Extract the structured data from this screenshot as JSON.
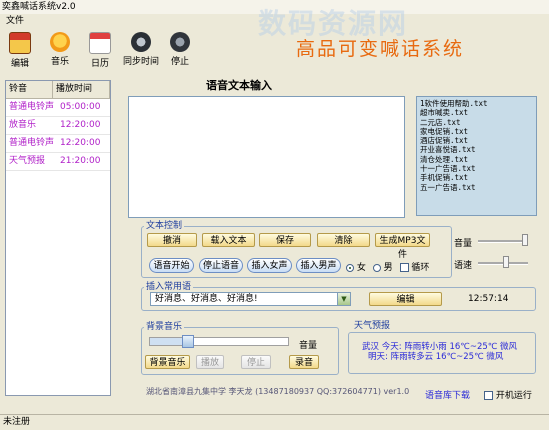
{
  "window": {
    "title": "奕鑫喊话系统v2.0"
  },
  "menu": {
    "file": "文件"
  },
  "toolbar": {
    "items": [
      {
        "label": "编辑",
        "icon": "calendar-red-icon"
      },
      {
        "label": "音乐",
        "icon": "music-face-icon"
      },
      {
        "label": "日历",
        "icon": "calendar-icon"
      },
      {
        "label": "同步时间",
        "icon": "clock-sync-icon"
      },
      {
        "label": "停止",
        "icon": "stop-icon"
      }
    ],
    "brand": "高品可变喊话系统"
  },
  "watermark": "数码资源网",
  "schedule": {
    "headers": [
      "铃音",
      "播放时间"
    ],
    "rows": [
      {
        "name": "普通电铃声",
        "time": "05:00:00"
      },
      {
        "name": "放音乐",
        "time": "12:20:00"
      },
      {
        "name": "普通电铃声",
        "time": "12:20:00"
      },
      {
        "name": "天气预报",
        "time": "21:20:00"
      }
    ]
  },
  "speech": {
    "title": "语音文本输入",
    "text_value": ""
  },
  "files": [
    "1软件使用帮助.txt",
    "超市喊卖.txt",
    "二元店.txt",
    "家电促销.txt",
    "酒店促销.txt",
    "开业喜悦语.txt",
    "清仓处理.txt",
    "十一广告语.txt",
    "手机促销.txt",
    "五一广告语.txt"
  ],
  "text_control": {
    "label": "文本控制",
    "cancel": "撤消",
    "load_text": "载入文本",
    "save": "保存",
    "clear": "清除",
    "make_mp3": "生成MP3文件",
    "volume_label": "音量",
    "speed_label": "语速",
    "start_voice": "语音开始",
    "stop_voice": "停止语音",
    "insert_female": "插入女声",
    "insert_male": "插入男声",
    "female": "女",
    "male": "男",
    "loop": "循环"
  },
  "phrases": {
    "label": "插入常用语",
    "selected": "好消息、好消息、好消息!",
    "edit": "编辑",
    "clock": "12:57:14"
  },
  "bg_music": {
    "label": "背景音乐",
    "volume_label": "音量",
    "music_btn": "背景音乐",
    "play": "播放",
    "stop": "停止",
    "record": "录音",
    "volume": 0.25
  },
  "weather": {
    "label": "天气预报",
    "line1": "武汉  今天: 阵雨转小雨 16℃~25℃ 微风",
    "line2": "明天: 阵雨转多云 16℃~25℃ 微风"
  },
  "footer": {
    "credit": "湖北省南漳县九集中学  李天龙 (13487180937 QQ:372604771)  ver1.0",
    "download": "语音库下载",
    "autostart": "开机运行"
  },
  "status": {
    "text": "未注册"
  },
  "colors": {
    "brand": "#e86a10",
    "schedule_text": "#b01fc8",
    "weather_text": "#2a2ad8",
    "button_gold": "#f3d98a",
    "file_bg": "#c8dce8"
  }
}
